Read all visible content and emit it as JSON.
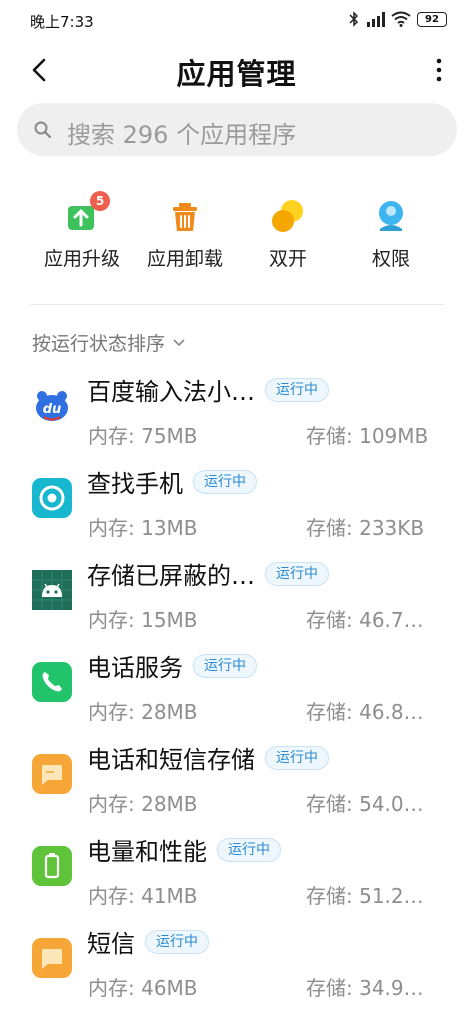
{
  "status_bar": {
    "time": "晚上7:33",
    "battery": "92"
  },
  "header": {
    "title": "应用管理"
  },
  "search": {
    "placeholder": "搜索 296 个应用程序"
  },
  "quick_actions": [
    {
      "label": "应用升级",
      "icon": "upgrade-icon",
      "badge": "5",
      "color": "#3ec25c"
    },
    {
      "label": "应用卸载",
      "icon": "trash-icon",
      "color": "#f08a1c"
    },
    {
      "label": "双开",
      "icon": "dual-app-icon",
      "color": "#f5b700"
    },
    {
      "label": "权限",
      "icon": "permission-icon",
      "color": "#3db5f0"
    }
  ],
  "sort": {
    "label": "按运行状态排序"
  },
  "running_label": "运行中",
  "apps": [
    {
      "name": "百度输入法小…",
      "running": "运行中",
      "memory": "内存: 75MB",
      "storage": "存储: 109MB",
      "icon": "baidu-du-icon"
    },
    {
      "name": "查找手机",
      "running": "运行中",
      "memory": "内存: 13MB",
      "storage": "存储: 233KB",
      "icon": "find-device-icon"
    },
    {
      "name": "存储已屏蔽的…",
      "running": "运行中",
      "memory": "内存: 15MB",
      "storage": "存储: 46.7…",
      "icon": "android-icon"
    },
    {
      "name": "电话服务",
      "running": "运行中",
      "memory": "内存: 28MB",
      "storage": "存储: 46.8…",
      "icon": "phone-icon"
    },
    {
      "name": "电话和短信存储",
      "running": "运行中",
      "memory": "内存: 28MB",
      "storage": "存储: 54.0…",
      "icon": "message-storage-icon"
    },
    {
      "name": "电量和性能",
      "running": "运行中",
      "memory": "内存: 41MB",
      "storage": "存储: 51.2…",
      "icon": "battery-icon"
    },
    {
      "name": "短信",
      "running": "运行中",
      "memory": "内存: 46MB",
      "storage": "存储: 34.9…",
      "icon": "sms-icon"
    }
  ]
}
